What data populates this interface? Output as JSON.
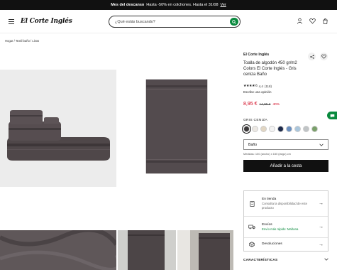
{
  "promo": {
    "bold": "Mes del descanso",
    "text": "Hasta -50% en colchones. Hasta el 31/08",
    "link": "Ver"
  },
  "header": {
    "logo": "El Corte Inglés",
    "search_placeholder": "¿Qué estás buscando?",
    "icons": [
      "user-icon",
      "heart-icon",
      "bag-icon"
    ]
  },
  "breadcrumb": [
    "Hogar",
    "Textil baño",
    "Lisos"
  ],
  "product": {
    "brand": "El Corte Inglés",
    "title": "Toalla de algodón 450 gr/m2 Colors El Corte Inglés - Gris ceniza Baño",
    "stars": "★★★★½",
    "rating": "4,4",
    "reviews_count": "(118)",
    "write_review": "Escribe una opinión",
    "price_now": "8,95 €",
    "price_old": "14,95 €",
    "discount": "40%",
    "color_label": "GRIS CENIZA",
    "swatches": [
      "#3b3839",
      "#ece8e3",
      "#e2d6c3",
      "#f3f3f3",
      "#1d2a4a",
      "#6a8fbf",
      "#aac6dc",
      "#c0c4c6",
      "#7aa06a"
    ],
    "size_selected": "Baño",
    "measure": "Medidas: 100 (ancho) x 150 (largo) cm",
    "add_to_cart": "Añadir a la cesta"
  },
  "services": [
    {
      "title": "En tienda",
      "sub": "Consulta la disponibilidad de este producto",
      "icon": "store-icon",
      "green": false
    },
    {
      "title": "Envíos",
      "sub": "Envío más rápido: Mañana",
      "icon": "truck-icon",
      "green": true
    },
    {
      "title": "Devoluciones",
      "sub": "",
      "icon": "returns-icon",
      "green": false
    }
  ],
  "caracteristicas": "CARACTERÍSTICAS",
  "colors": {
    "accent_green": "#0a8a3e",
    "price_red": "#d0021b",
    "towel": "#534b4e"
  }
}
